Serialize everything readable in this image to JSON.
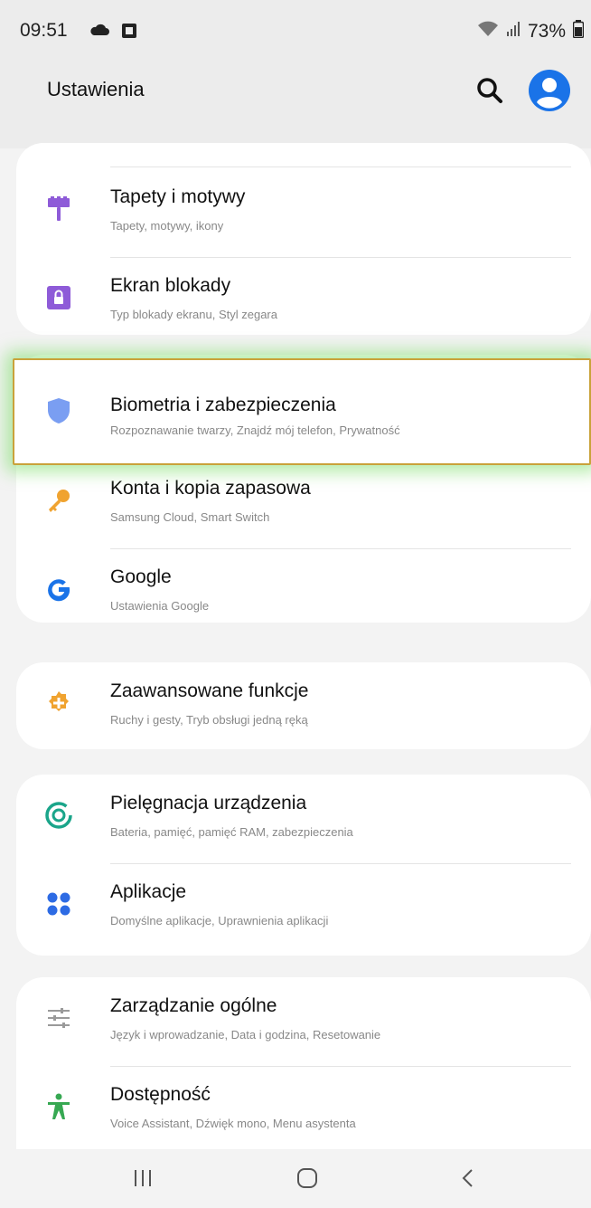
{
  "status": {
    "time": "09:51",
    "battery": "73%"
  },
  "header": {
    "title": "Ustawienia"
  },
  "items": [
    {
      "title": "Tapety i motywy",
      "sub": "Tapety, motywy, ikony",
      "icon": "paint-roller-icon"
    },
    {
      "title": "Ekran blokady",
      "sub": "Typ blokady ekranu, Styl zegara",
      "icon": "lock-icon"
    },
    {
      "title": "Biometria i zabezpieczenia",
      "sub": "Rozpoznawanie twarzy, Znajdź mój telefon, Prywatność",
      "icon": "shield-icon"
    },
    {
      "title": "Konta i kopia zapasowa",
      "sub": "Samsung Cloud, Smart Switch",
      "icon": "key-icon"
    },
    {
      "title": "Google",
      "sub": "Ustawienia Google",
      "icon": "google-icon"
    },
    {
      "title": "Zaawansowane funkcje",
      "sub": "Ruchy i gesty, Tryb obsługi jedną ręką",
      "icon": "gear-plus-icon"
    },
    {
      "title": "Pielęgnacja urządzenia",
      "sub": "Bateria, pamięć, pamięć RAM, zabezpieczenia",
      "icon": "device-care-icon"
    },
    {
      "title": "Aplikacje",
      "sub": "Domyślne aplikacje, Uprawnienia aplikacji",
      "icon": "apps-icon"
    },
    {
      "title": "Zarządzanie ogólne",
      "sub": "Język i wprowadzanie, Data i godzina, Resetowanie",
      "icon": "sliders-icon"
    },
    {
      "title": "Dostępność",
      "sub": "Voice Assistant, Dźwięk mono, Menu asystenta",
      "icon": "accessibility-icon"
    }
  ],
  "colors": {
    "accent_blue": "#1a73e8",
    "icon_purple": "#8e5bd8",
    "icon_orange": "#f0a330",
    "icon_teal": "#1aa58a",
    "icon_green": "#36a852",
    "highlight_border": "#c9a23a",
    "highlight_glow": "#78dc64"
  }
}
